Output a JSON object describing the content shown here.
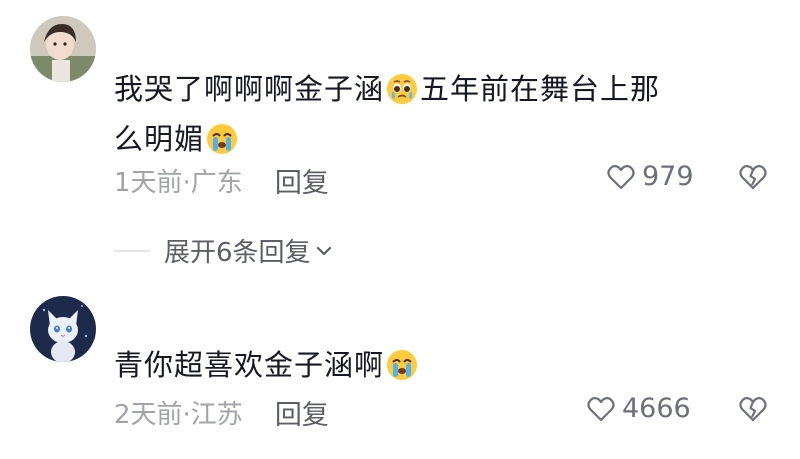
{
  "comments": [
    {
      "text_a": "我哭了啊啊啊金子涵",
      "emoji_a": "pleading-face-emoji",
      "text_b": "五年前在舞台上那",
      "text_c": "么明媚",
      "emoji_b": "loudly-crying-emoji",
      "time": "1天前",
      "location": "·广东",
      "reply_label": "回复",
      "likes": "979"
    },
    {
      "text_a": "青你超喜欢金子涵啊",
      "emoji_a": "loudly-crying-emoji",
      "time": "2天前",
      "location": "·江苏",
      "reply_label": "回复",
      "likes": "4666"
    }
  ],
  "expand_replies": {
    "label": "展开6条回复"
  },
  "icons": {
    "like": "heart-outline-icon",
    "dislike": "broken-heart-icon",
    "expand": "chevron-down-icon"
  },
  "colors": {
    "text": "#161823",
    "meta": "#a1a3a8",
    "action": "#5c5e66"
  }
}
